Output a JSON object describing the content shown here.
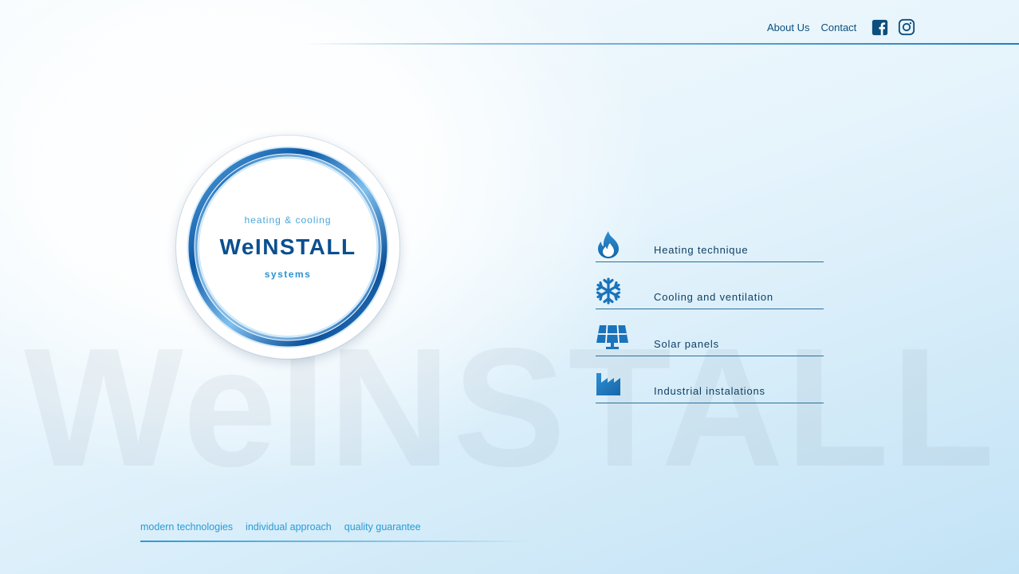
{
  "nav": {
    "about_label": "About Us",
    "contact_label": "Contact",
    "facebook_icon": "facebook-icon",
    "instagram_icon": "instagram-icon"
  },
  "logo": {
    "tagline": "heating & cooling",
    "title": "WeINSTALL",
    "subtitle": "systems"
  },
  "watermark": "WeINSTALL",
  "services": [
    {
      "label": "Heating technique",
      "icon": "flame-icon"
    },
    {
      "label": "Cooling and ventilation",
      "icon": "snowflake-icon"
    },
    {
      "label": "Solar panels",
      "icon": "solar-panel-icon"
    },
    {
      "label": "Industrial instalations",
      "icon": "factory-icon"
    }
  ],
  "slogans": [
    "modern technologies",
    "individual approach",
    "quality guarantee"
  ],
  "colors": {
    "brand_dark": "#0b4f8f",
    "brand_accent": "#2a9bd2",
    "nav_text": "#0d4f7e"
  }
}
